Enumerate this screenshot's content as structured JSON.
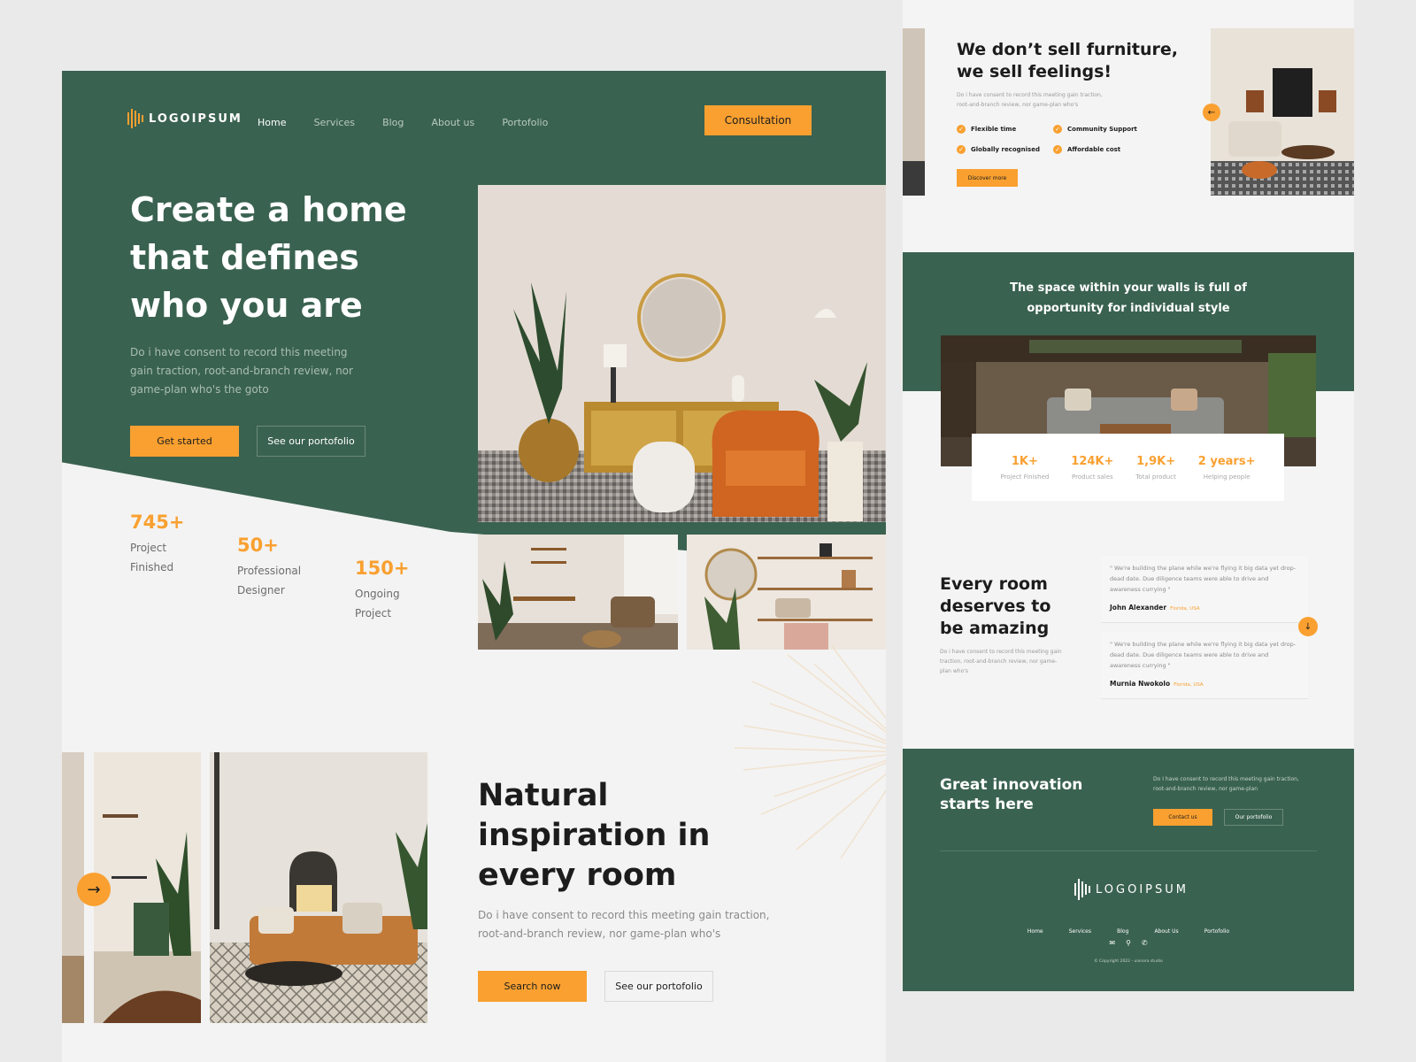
{
  "brand": {
    "name": "LOGOIPSUM",
    "accent": "#f9a030",
    "green": "#3a6250"
  },
  "nav": {
    "items": [
      {
        "label": "Home",
        "active": true
      },
      {
        "label": "Services",
        "active": false
      },
      {
        "label": "Blog",
        "active": false
      },
      {
        "label": "About us",
        "active": false
      },
      {
        "label": "Portofolio",
        "active": false
      }
    ],
    "cta": "Consultation"
  },
  "hero": {
    "title_line1": "Create a home",
    "title_line2": "that defines",
    "title_line3": "who you are",
    "text": "Do i have consent to record this meeting gain traction, root-and-branch review, nor game-plan who's the goto",
    "primary_btn": "Get started",
    "secondary_btn": "See our portofolio"
  },
  "stats": [
    {
      "value": "745+",
      "label": "Project Finished"
    },
    {
      "value": "50+",
      "label": "Professional Designer"
    },
    {
      "value": "150+",
      "label": "Ongoing Project"
    }
  ],
  "inspiration": {
    "title_line1": "Natural",
    "title_line2": "inspiration in",
    "title_line3": "every room",
    "text": "Do i have consent to record this meeting gain traction, root-and-branch review, nor game-plan who's",
    "primary_btn": "Search now",
    "secondary_btn": "See our portofolio",
    "arrow": "arrow-right-icon"
  },
  "feelings": {
    "title_line1": "We don’t sell furniture,",
    "title_line2": "we sell feelings!",
    "text": "Do i have consent to record this meeting gain traction, root-and-branch review, nor game-plan who's",
    "features": [
      "Flexible time",
      "Community Support",
      "Globally recognised",
      "Affordable cost"
    ],
    "button": "Discover more"
  },
  "space": {
    "title_line1": "The space within your walls is full of",
    "title_line2": "opportunity for individual style",
    "stats": [
      {
        "value": "1K+",
        "label": "Project Finished"
      },
      {
        "value": "124K+",
        "label": "Product sales"
      },
      {
        "value": "1,9K+",
        "label": "Total product"
      },
      {
        "value": "2 years+",
        "label": "Helping people"
      }
    ]
  },
  "testimonials": {
    "title_line1": "Every room",
    "title_line2": "deserves to",
    "title_line3": "be amazing",
    "text": "Do i have consent to record this meeting gain traction, root-and-branch review, nor game-plan who's",
    "items": [
      {
        "quote": "\" We're building the plane while we're flying it big data yet drop-dead date. Due diligence teams were able to drive and awareness currying \"",
        "name": "John Alexander",
        "location": "Florida, USA"
      },
      {
        "quote": "\" We're building the plane while we're flying it big data yet drop-dead date. Due diligence teams were able to drive and awareness currying \"",
        "name": "Murnia Nwokolo",
        "location": "Florida, USA"
      }
    ]
  },
  "cta_section": {
    "title_line1": "Great innovation",
    "title_line2": "starts here",
    "text": "Do I have consent to record this meeting gain traction, root-and-branch review, nor game-plan",
    "primary_btn": "Contact us",
    "secondary_btn": "Our portofolio"
  },
  "footer": {
    "brand": "LOGOIPSUM",
    "links": [
      "Home",
      "Services",
      "Blog",
      "About Us",
      "Portofolio"
    ],
    "icons": [
      "mail-icon",
      "location-icon",
      "phone-icon"
    ],
    "copyright": "© Copyright 2022 - uixnora studio"
  }
}
